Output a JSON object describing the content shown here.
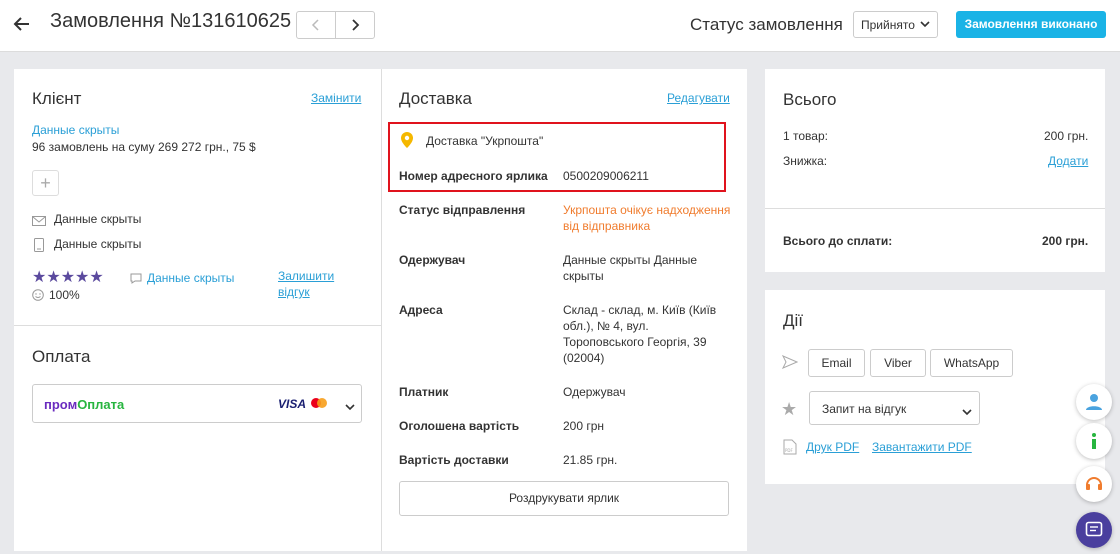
{
  "header": {
    "title": "Замовлення №131610625",
    "status_label": "Статус замовлення",
    "status_value": "Прийнято",
    "done_button": "Замовлення виконано"
  },
  "client": {
    "heading": "Клієнт",
    "change_link": "Замінити",
    "name_link": "Данные скрыты",
    "orders_summary": "96 замовлень на суму 269 272 грн., 75 $",
    "email": "Данные скрыты",
    "phone": "Данные скрыты",
    "review_user": "Данные скрыты",
    "rating_percent": "100%",
    "leave_review_1": "Залишити",
    "leave_review_2": "відгук",
    "stars": 5
  },
  "payment": {
    "heading": "Оплата",
    "brand_prom": "пром",
    "brand_oplata": "Оплата",
    "visa": "VISA"
  },
  "delivery": {
    "heading": "Доставка",
    "edit_link": "Редагувати",
    "method": "Доставка \"Укрпошта\"",
    "rows": [
      {
        "label": "Номер адресного ярлика",
        "value": "0500209006211"
      },
      {
        "label": "Статус відправлення",
        "value": "Укрпошта очікує надходження від відправника"
      },
      {
        "label": "Одержувач",
        "value": "Данные скрыты Данные скрыты"
      },
      {
        "label": "Адреса",
        "value": "Склад - склад, м. Київ (Київ обл.), № 4, вул. Тороповського Георгія, 39 (02004)"
      },
      {
        "label": "Платник",
        "value": "Одержувач"
      },
      {
        "label": "Оголошена вартість",
        "value": "200 грн"
      },
      {
        "label": "Вартість доставки",
        "value": "21.85 грн."
      }
    ],
    "print_label": "Роздрукувати ярлик",
    "status_color": "#f07c2e",
    "highlight_color": "#e0131d"
  },
  "total": {
    "heading": "Всього",
    "items_label": "1 товар:",
    "items_value": "200 грн.",
    "discount_label": "Знижка:",
    "discount_link": "Додати",
    "to_pay_label": "Всього до сплати:",
    "to_pay_value": "200 грн."
  },
  "actions": {
    "heading": "Дії",
    "email": "Email",
    "viber": "Viber",
    "whatsapp": "WhatsApp",
    "review_select": "Запит на відгук",
    "print_pdf": "Друк PDF",
    "download_pdf": "Завантажити PDF"
  },
  "colors": {
    "accent": "#1ab3e6",
    "link": "#2a9fd6",
    "star": "#5b4a9e"
  }
}
